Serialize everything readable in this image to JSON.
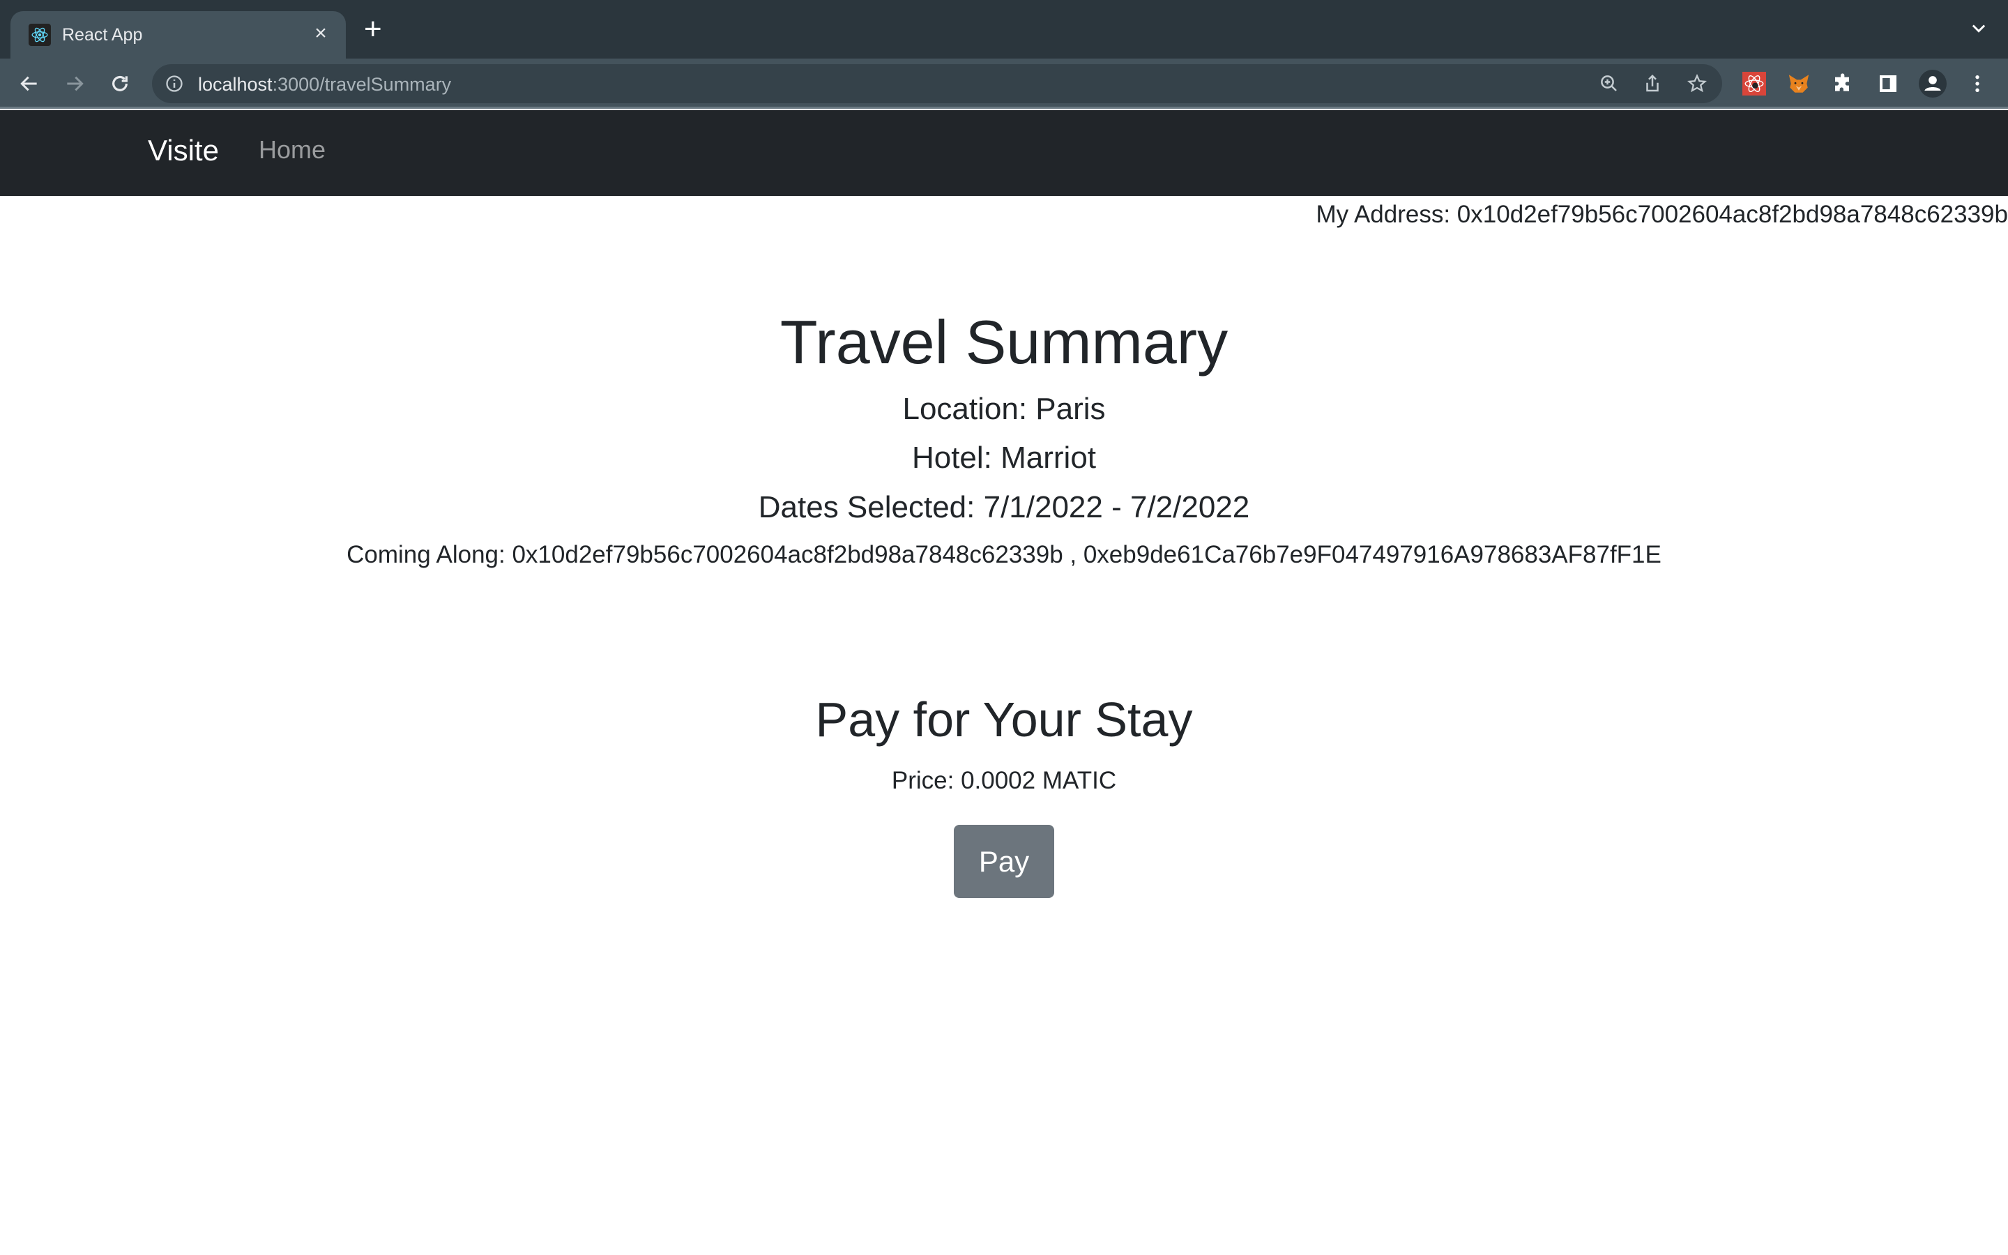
{
  "browser": {
    "tab": {
      "title": "React App",
      "close_glyph": "×",
      "favicon": "react-icon"
    },
    "new_tab_glyph": "+",
    "url_host": "localhost",
    "url_path": ":3000/travelSummary",
    "icons": [
      "back-icon",
      "forward-icon",
      "reload-icon",
      "info-icon",
      "zoom-icon",
      "share-icon",
      "star-icon",
      "react-devtools-icon",
      "metamask-icon",
      "extensions-icon",
      "side-panel-icon",
      "profile-icon",
      "menu-icon"
    ]
  },
  "navbar": {
    "brand": "Visite",
    "links": [
      {
        "label": "Home"
      }
    ]
  },
  "account": {
    "my_address": "My Address: 0x10d2ef79b56c7002604ac8f2bd98a7848c62339b"
  },
  "summary": {
    "title": "Travel Summary",
    "location": "Location: Paris",
    "hotel": "Hotel: Marriot",
    "dates": "Dates Selected: 7/1/2022 - 7/2/2022",
    "coming_along": "Coming Along: 0x10d2ef79b56c7002604ac8f2bd98a7848c62339b , 0xeb9de61Ca76b7e9F047497916A978683AF87fF1E"
  },
  "payment": {
    "title": "Pay for Your Stay",
    "price": "Price: 0.0002 MATIC",
    "button_label": "Pay"
  },
  "colors": {
    "navbar_bg": "#212529",
    "button_bg": "#6c757d",
    "text": "#212529"
  }
}
